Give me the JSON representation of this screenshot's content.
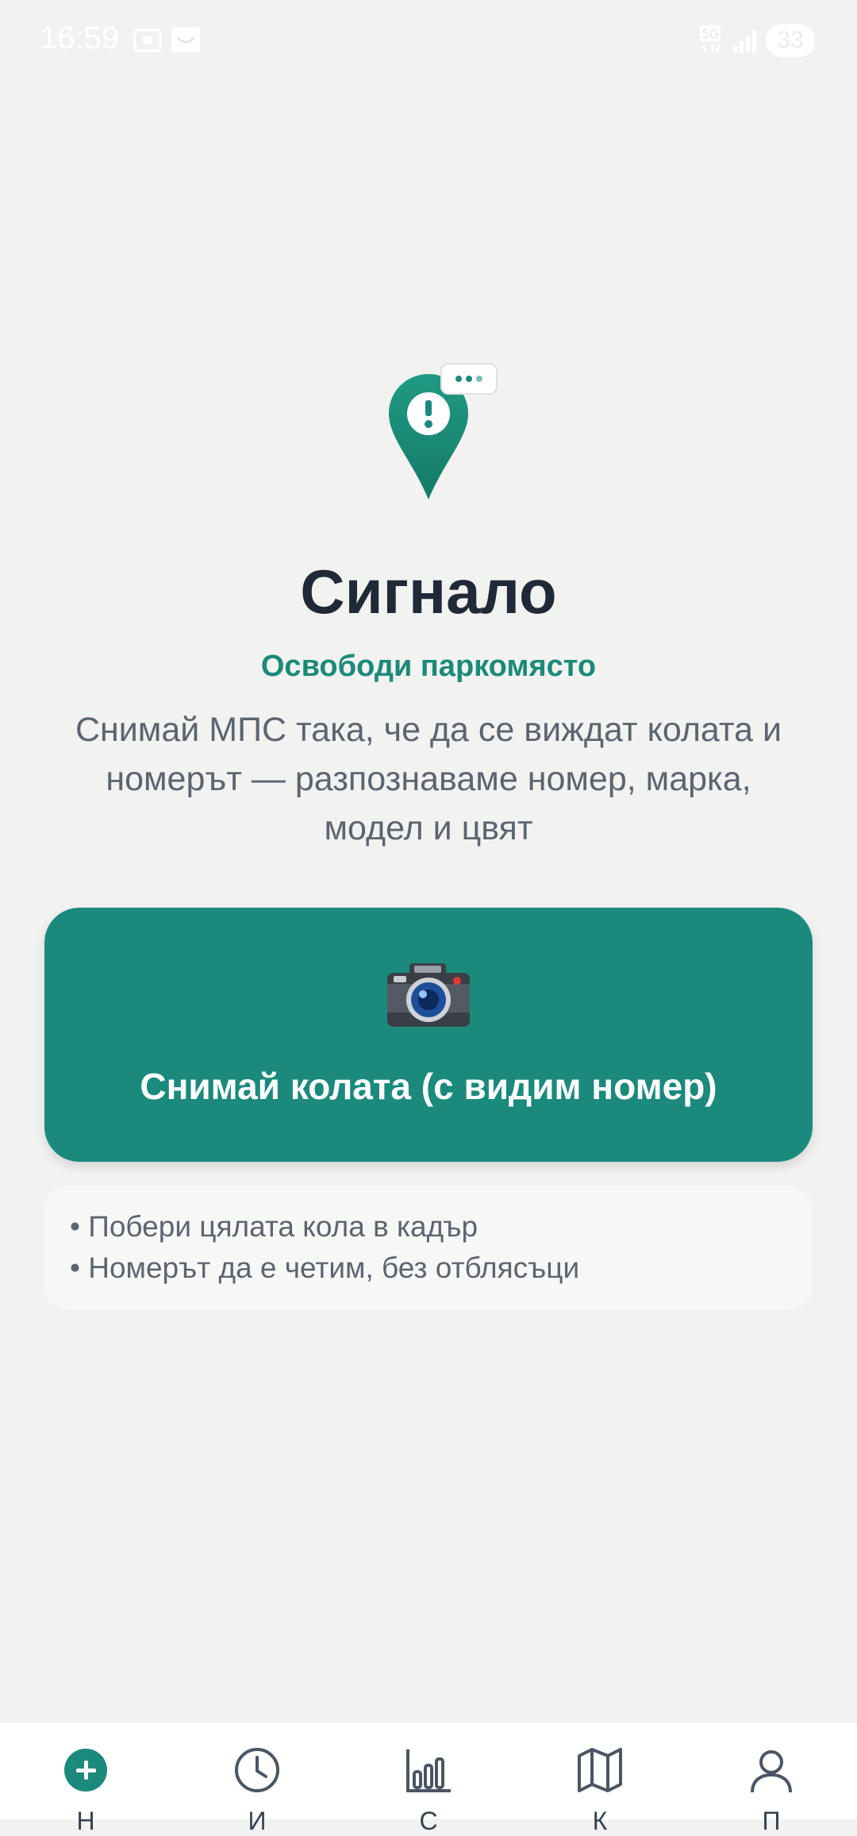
{
  "status_bar": {
    "time": "16:59",
    "signal_label": "5G",
    "battery": "33"
  },
  "hero": {
    "icon": "map-pin-alert-icon",
    "title": "Сигнало",
    "subtitle": "Освободи паркомясто",
    "description": "Снимай МПС така, че да се виждат колата и номерът — разпознаваме номер, марка, модел и цвят"
  },
  "capture_button": {
    "icon": "camera-icon",
    "label": "Снимай колата (с видим номер)"
  },
  "tips": [
    "• Побери цялата кола в кадър",
    "• Номерът да е четим, без отблясъци"
  ],
  "bottom_nav": [
    {
      "icon": "add-circle-icon",
      "label": "Н",
      "active": true
    },
    {
      "icon": "clock-icon",
      "label": "И"
    },
    {
      "icon": "bar-chart-icon",
      "label": "С"
    },
    {
      "icon": "map-icon",
      "label": "К"
    },
    {
      "icon": "user-icon",
      "label": "П"
    }
  ],
  "colors": {
    "accent": "#1b8a7d",
    "background": "#f2f2f1",
    "title": "#1f2937",
    "text": "#5c6470"
  }
}
